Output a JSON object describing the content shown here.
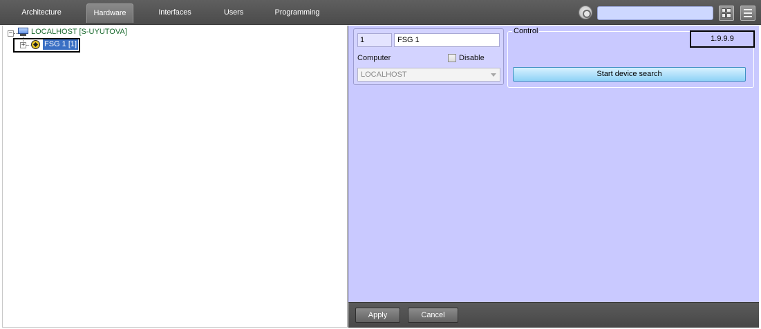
{
  "tabs": [
    {
      "label": "Architecture"
    },
    {
      "label": "Hardware"
    },
    {
      "label": "Interfaces"
    },
    {
      "label": "Users"
    },
    {
      "label": "Programming"
    }
  ],
  "active_tab": "Hardware",
  "toolbar": {
    "settings_icon": "gear-icon",
    "search_value": "",
    "layout_icon": "grid-icon",
    "menu_icon": "menu-icon"
  },
  "tree": {
    "root": {
      "label": "LOCALHOST [S-UYUTOVA]",
      "expander": "−",
      "icon": "computer-icon"
    },
    "child": {
      "label": "FSG 1 [1]",
      "expander": "+",
      "icon": "device-icon"
    }
  },
  "object": {
    "id": "1",
    "name": "FSG 1",
    "computer_label": "Computer",
    "disable_label": "Disable",
    "disable_checked": false,
    "computer_value": "LOCALHOST"
  },
  "control": {
    "legend": "Control",
    "version": "1.9.9.9",
    "search_button": "Start device search"
  },
  "footer": {
    "apply": "Apply",
    "cancel": "Cancel"
  },
  "colors": {
    "settings_bg": "#c9c9ff",
    "topbar_bg": "#555555",
    "search_field": "#cdd8ff",
    "selected_item": "#3a6fc4",
    "search_button": "#a6dcfa"
  }
}
